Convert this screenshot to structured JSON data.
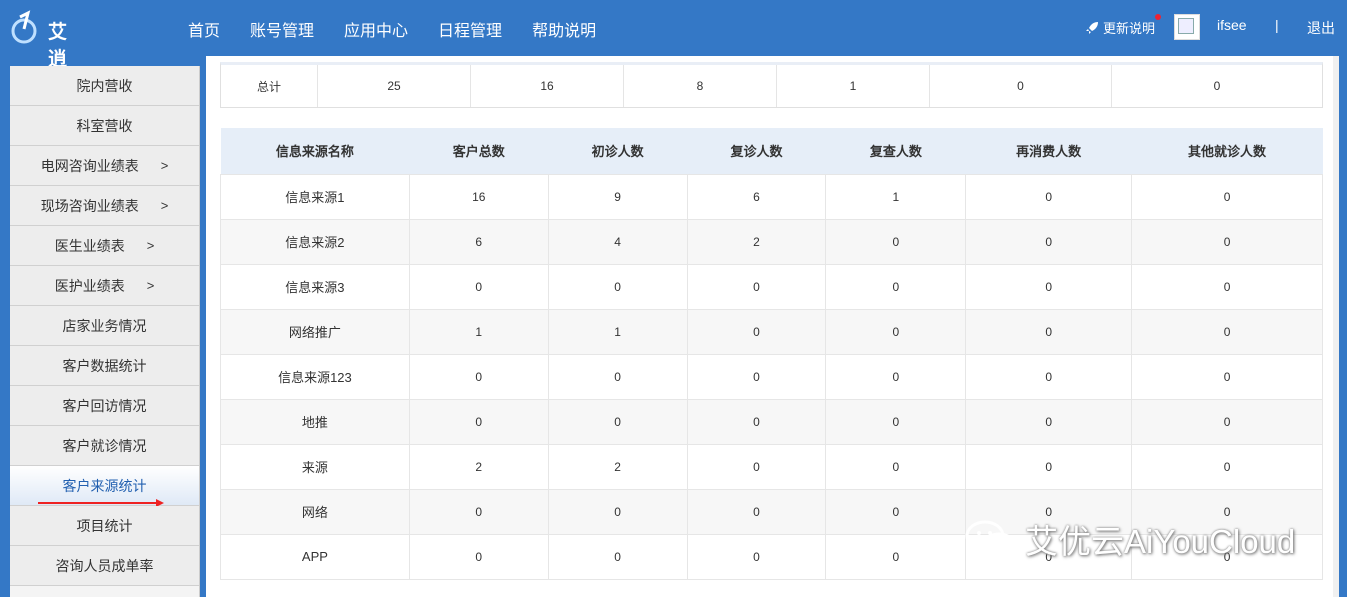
{
  "header": {
    "logo_text": "艾逍",
    "nav": [
      "首页",
      "账号管理",
      "应用中心",
      "日程管理",
      "帮助说明"
    ],
    "update_label": "更新说明",
    "username": "ifsee",
    "separator": "|",
    "logout_label": "退出"
  },
  "sidebar": {
    "items": [
      {
        "label": "院内营收",
        "arrow": ""
      },
      {
        "label": "科室营收",
        "arrow": ""
      },
      {
        "label": "电网咨询业绩表",
        "arrow": ">"
      },
      {
        "label": "现场咨询业绩表",
        "arrow": ">"
      },
      {
        "label": "医生业绩表",
        "arrow": ">"
      },
      {
        "label": "医护业绩表",
        "arrow": ">"
      },
      {
        "label": "店家业务情况",
        "arrow": ""
      },
      {
        "label": "客户数据统计",
        "arrow": ""
      },
      {
        "label": "客户回访情况",
        "arrow": ""
      },
      {
        "label": "客户就诊情况",
        "arrow": ""
      },
      {
        "label": "客户来源统计",
        "arrow": ""
      },
      {
        "label": "项目统计",
        "arrow": ""
      },
      {
        "label": "咨询人员成单率",
        "arrow": ""
      }
    ],
    "active_item": "客户来源统计"
  },
  "totals": [
    "总计",
    "25",
    "16",
    "8",
    "1",
    "0",
    "0"
  ],
  "table": {
    "headers": [
      "信息来源名称",
      "客户总数",
      "初诊人数",
      "复诊人数",
      "复查人数",
      "再消费人数",
      "其他就诊人数"
    ],
    "rows": [
      [
        "信息来源1",
        "16",
        "9",
        "6",
        "1",
        "0",
        "0"
      ],
      [
        "信息来源2",
        "6",
        "4",
        "2",
        "0",
        "0",
        "0"
      ],
      [
        "信息来源3",
        "0",
        "0",
        "0",
        "0",
        "0",
        "0"
      ],
      [
        "网络推广",
        "1",
        "1",
        "0",
        "0",
        "0",
        "0"
      ],
      [
        "信息来源123",
        "0",
        "0",
        "0",
        "0",
        "0",
        "0"
      ],
      [
        "地推",
        "0",
        "0",
        "0",
        "0",
        "0",
        "0"
      ],
      [
        "来源",
        "2",
        "2",
        "0",
        "0",
        "0",
        "0"
      ],
      [
        "网络",
        "0",
        "0",
        "0",
        "0",
        "0",
        "0"
      ],
      [
        "APP",
        "0",
        "0",
        "0",
        "0",
        "0",
        "0"
      ]
    ]
  },
  "watermark": "艾优云AiYouCloud",
  "colors": {
    "header_bg": "#3478c6",
    "table_header_bg": "#e6eef8",
    "active_text": "#2260b0",
    "annotation_red": "#e22"
  }
}
